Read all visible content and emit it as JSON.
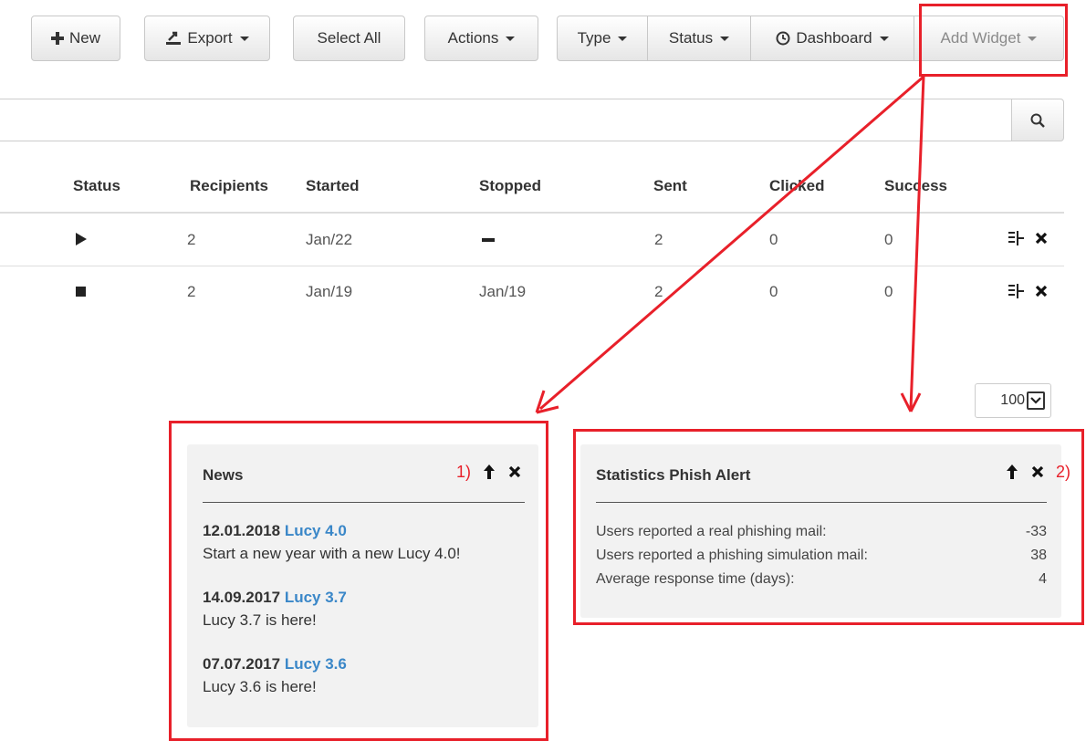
{
  "toolbar": {
    "new_label": "New",
    "export_label": "Export",
    "select_all_label": "Select All",
    "actions_label": "Actions",
    "type_label": "Type",
    "status_label": "Status",
    "dashboard_label": "Dashboard",
    "add_widget_label": "Add Widget"
  },
  "table": {
    "headers": [
      "Status",
      "Recipients",
      "Started",
      "Stopped",
      "Sent",
      "Clicked",
      "Success"
    ],
    "rows": [
      {
        "status_icon": "play-icon",
        "recipients": "2",
        "started": "Jan/22",
        "stopped_icon": "dash-icon",
        "stopped": "",
        "sent": "2",
        "clicked": "0",
        "success": "0"
      },
      {
        "status_icon": "stop-icon",
        "recipients": "2",
        "started": "Jan/19",
        "stopped": "Jan/19",
        "sent": "2",
        "clicked": "0",
        "success": "0"
      }
    ]
  },
  "pagination": {
    "per_page": "100"
  },
  "news_widget": {
    "title": "News",
    "annotation": "1)",
    "items": [
      {
        "date": "12.01.2018",
        "link": "Lucy 4.0",
        "text": "Start a new year with a new Lucy 4.0!"
      },
      {
        "date": "14.09.2017",
        "link": "Lucy 3.7",
        "text": "Lucy 3.7 is here!"
      },
      {
        "date": "07.07.2017",
        "link": "Lucy 3.6",
        "text": "Lucy 3.6 is here!"
      }
    ]
  },
  "stats_widget": {
    "title": "Statistics Phish Alert",
    "annotation": "2)",
    "rows": [
      {
        "label": "Users reported a real phishing mail:",
        "value": "-33"
      },
      {
        "label": "Users reported a phishing simulation mail:",
        "value": "38"
      },
      {
        "label": "Average response time (days):",
        "value": "4"
      }
    ]
  },
  "colors": {
    "annotation_red": "#e8202a",
    "link_blue": "#3a87c8"
  }
}
